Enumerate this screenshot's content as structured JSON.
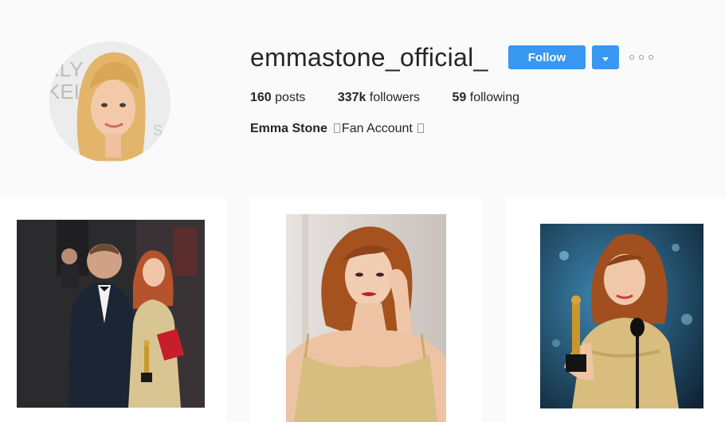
{
  "profile": {
    "username": "emmastone_official_",
    "follow_label": "Follow",
    "dropdown_icon": "caret-down-icon",
    "more_icon": "ellipsis-icon",
    "stats": [
      {
        "value": "160",
        "label": "posts"
      },
      {
        "value": "337k",
        "label": "followers"
      },
      {
        "value": "59",
        "label": "following"
      }
    ],
    "bio_name": "Emma Stone",
    "bio_text": "Fan Account"
  },
  "colors": {
    "accent": "#3897f0",
    "background": "#fafafa",
    "card": "#ffffff",
    "text": "#262626"
  },
  "posts": [
    {
      "icon": "photo-red-carpet-couple"
    },
    {
      "icon": "photo-portrait-gold-dress"
    },
    {
      "icon": "photo-oscar-speech"
    }
  ]
}
